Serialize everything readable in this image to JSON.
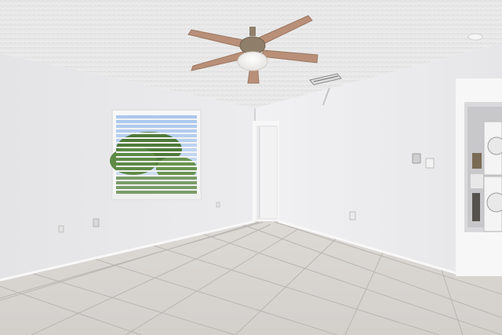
{
  "scene": {
    "kind": "interior photo",
    "room": "empty bedroom",
    "colors": {
      "ceiling": "#e8e8e8",
      "left_wall": "#e9e9eb",
      "right_wall": "#ededef",
      "floor_tile": "#d9d6d2",
      "grout": "#b9b6b2",
      "trim": "#f6f6f6",
      "fan_blade": "#b98f78",
      "fan_brass": "#8f7f6a"
    },
    "objects": [
      "ceiling-fan",
      "window-with-blinds",
      "interior-doorway",
      "laundry-closet",
      "stacked-washer-dryer",
      "ac-vent",
      "wall-outlets",
      "light-switch",
      "thermostat"
    ]
  }
}
